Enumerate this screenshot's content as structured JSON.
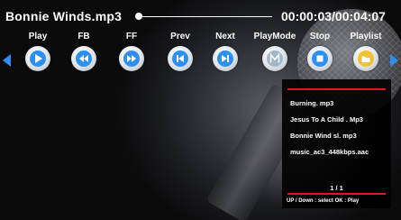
{
  "player": {
    "title": "Bonnie Winds.mp3",
    "time": "00:00:03/00:04:07",
    "progress": 0.012
  },
  "controls": [
    {
      "label": "Play",
      "icon": "play-icon"
    },
    {
      "label": "FB",
      "icon": "fast-backward-icon"
    },
    {
      "label": "FF",
      "icon": "fast-forward-icon"
    },
    {
      "label": "Prev",
      "icon": "previous-track-icon"
    },
    {
      "label": "Next",
      "icon": "next-track-icon"
    },
    {
      "label": "PlayMode",
      "icon": "playmode-m-icon"
    },
    {
      "label": "Stop",
      "icon": "stop-icon"
    },
    {
      "label": "Playlist",
      "icon": "playlist-folder-icon"
    }
  ],
  "playlist": {
    "items": [
      "Burning. mp3",
      "Jesus To A Child . Mp3",
      "Bonnie Wind sl. mp3",
      "music_ac3_448kbps.aac"
    ],
    "page": "1 / 1",
    "hint": "UP / Down : select    OK : Play"
  },
  "colors": {
    "accent_blue": "#2f8ff0",
    "panel_rule": "#e0161b",
    "folder_yellow": "#f2c230"
  }
}
